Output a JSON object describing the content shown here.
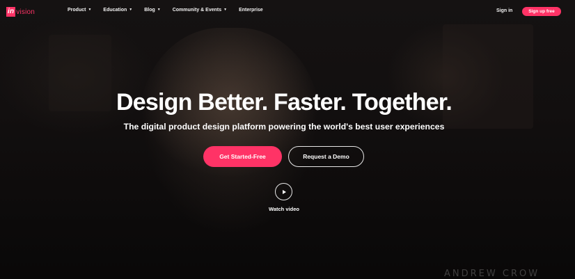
{
  "brand": {
    "logo_badge": "in",
    "logo_rest": "vision",
    "accent_color": "#ff3366"
  },
  "nav": {
    "items": [
      {
        "label": "Product",
        "has_dropdown": true
      },
      {
        "label": "Education",
        "has_dropdown": true
      },
      {
        "label": "Blog",
        "has_dropdown": true
      },
      {
        "label": "Community & Events",
        "has_dropdown": true
      },
      {
        "label": "Enterprise",
        "has_dropdown": false
      }
    ],
    "dropdown_glyph": "▼",
    "sign_in": "Sign in",
    "sign_up": "Sign up free"
  },
  "hero": {
    "title": "Design Better. Faster. Together.",
    "subtitle": "The digital product design platform powering the world's best user experiences",
    "primary_cta": "Get Started-Free",
    "secondary_cta": "Request a Demo",
    "watch_video": "Watch video"
  },
  "video_overlay": {
    "watermark": "ANDREW CROW"
  },
  "icons": {
    "play": "play-icon",
    "chevron": "chevron-down-icon"
  }
}
